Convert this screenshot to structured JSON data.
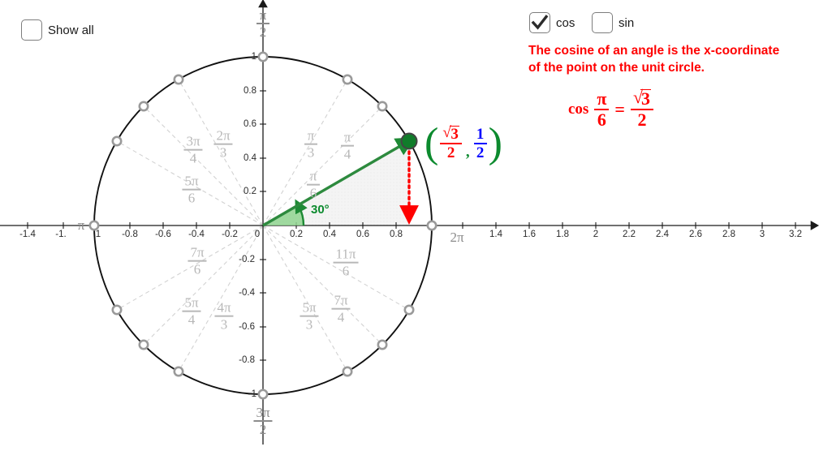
{
  "controls": {
    "show_all": {
      "label": "Show all",
      "checked": false
    },
    "cos": {
      "label": "cos",
      "checked": true
    },
    "sin": {
      "label": "sin",
      "checked": false
    }
  },
  "explanation": {
    "line1": "The cosine of an angle is the x-coordinate",
    "line2": "of the point on the unit circle.",
    "color": "#ff0000",
    "formula": {
      "func": "cos",
      "arg_num": "π",
      "arg_den": "6",
      "equals": "=",
      "result_num": "3",
      "result_den": "2",
      "result_radical": "√"
    }
  },
  "chart_data": {
    "type": "scatter",
    "title": "",
    "xlabel": "",
    "ylabel": "",
    "xlim": [
      -1.5,
      3.3
    ],
    "ylim": [
      -1.15,
      1.15
    ],
    "grid": false,
    "x_ticks": [
      "-1.4",
      "-1",
      "-0.8",
      "-0.6",
      "-0.4",
      "-0.2",
      "0",
      "0.2",
      "0.4",
      "0.6",
      "0.8",
      "1.4",
      "1.6",
      "1.8",
      "2",
      "2.2",
      "2.4",
      "2.6",
      "2.8",
      "3",
      "3.2"
    ],
    "x_tick_values": [
      -1.4,
      -1.2,
      -0.8,
      -0.6,
      -0.4,
      -0.2,
      0,
      0.2,
      0.4,
      0.6,
      0.8,
      1.4,
      1.6,
      1.8,
      2,
      2.2,
      2.4,
      2.6,
      2.8,
      3,
      3.2
    ],
    "y_ticks": [
      "1",
      "0.8",
      "0.6",
      "0.4",
      "0.2",
      "0",
      "-0.2",
      "-0.4",
      "-0.6",
      "-0.8",
      "-1"
    ],
    "y_tick_values": [
      1,
      0.8,
      0.6,
      0.4,
      0.2,
      0,
      -0.2,
      -0.4,
      -0.6,
      -0.8,
      -1
    ],
    "axis_special_labels": [
      {
        "text": "π",
        "x": -1.11,
        "y": 0,
        "note": "pi at x=-1 region"
      },
      {
        "text": "2π",
        "x": 1.15,
        "y": -0.09,
        "note": "2pi just right of x=1"
      },
      {
        "text": "π/2",
        "x": 0,
        "y": 1.22,
        "note": "top of y-axis"
      },
      {
        "text": "3π/2",
        "x": 0,
        "y": -1.21,
        "note": "bottom of y-axis"
      }
    ],
    "unit_circle": {
      "center": [
        0,
        0
      ],
      "radius": 1,
      "color": "#000000"
    },
    "special_angles": [
      {
        "label": "π/6",
        "degrees": 30,
        "label_x": 0.3,
        "label_y": 0.23
      },
      {
        "label": "π/4",
        "degrees": 45,
        "label_x": 0.41,
        "label_y": 0.51
      },
      {
        "label": "π/3",
        "degrees": 60,
        "label_x": 0.22,
        "label_y": 0.52
      },
      {
        "label": "2π/3",
        "degrees": 120,
        "label_x": -0.24,
        "label_y": 0.52
      },
      {
        "label": "3π/4",
        "degrees": 135,
        "label_x": -0.42,
        "label_y": 0.51
      },
      {
        "label": "5π/6",
        "degrees": 150,
        "label_x": -0.41,
        "label_y": 0.24
      },
      {
        "label": "7π/6",
        "degrees": 210,
        "label_x": -0.38,
        "label_y": -0.24
      },
      {
        "label": "5π/4",
        "degrees": 225,
        "label_x": -0.42,
        "label_y": -0.53
      },
      {
        "label": "4π/3",
        "degrees": 240,
        "label_x": -0.23,
        "label_y": -0.55
      },
      {
        "label": "5π/3",
        "degrees": 300,
        "label_x": 0.25,
        "label_y": -0.55
      },
      {
        "label": "7π/4",
        "degrees": 315,
        "label_x": 0.44,
        "label_y": -0.52
      },
      {
        "label": "11π/6",
        "degrees": 330,
        "label_x": 0.48,
        "label_y": -0.24
      }
    ],
    "marker_angles_deg": [
      0,
      30,
      45,
      60,
      90,
      120,
      135,
      150,
      180,
      210,
      225,
      240,
      270,
      300,
      315,
      330
    ],
    "active_point": {
      "angle_degrees": 30,
      "angle_label": "30°",
      "x": 0.8660254,
      "y": 0.5,
      "color": "#107c2a",
      "coord_label": {
        "x_num_radical": "√",
        "x_num": "3",
        "x_den": "2",
        "y_num": "1",
        "y_den": "2",
        "separator": ",",
        "x_color": "#ff0000",
        "y_color": "#0000ff",
        "paren_color": "#0c8a2e"
      }
    },
    "cosine_drop_line": {
      "from": [
        0.8660254,
        0.5
      ],
      "to": [
        0.8660254,
        0.0
      ],
      "color": "#ff0000",
      "style": "dotted-arrow"
    },
    "shaded_triangle": {
      "fill": "#f2f2f2",
      "vertices": [
        [
          0,
          0
        ],
        [
          0.866,
          0.5
        ],
        [
          0.866,
          0
        ]
      ]
    },
    "angle_sector": {
      "fill": "#8fd48f",
      "radius": 0.24,
      "from_deg": 0,
      "to_deg": 30
    }
  }
}
